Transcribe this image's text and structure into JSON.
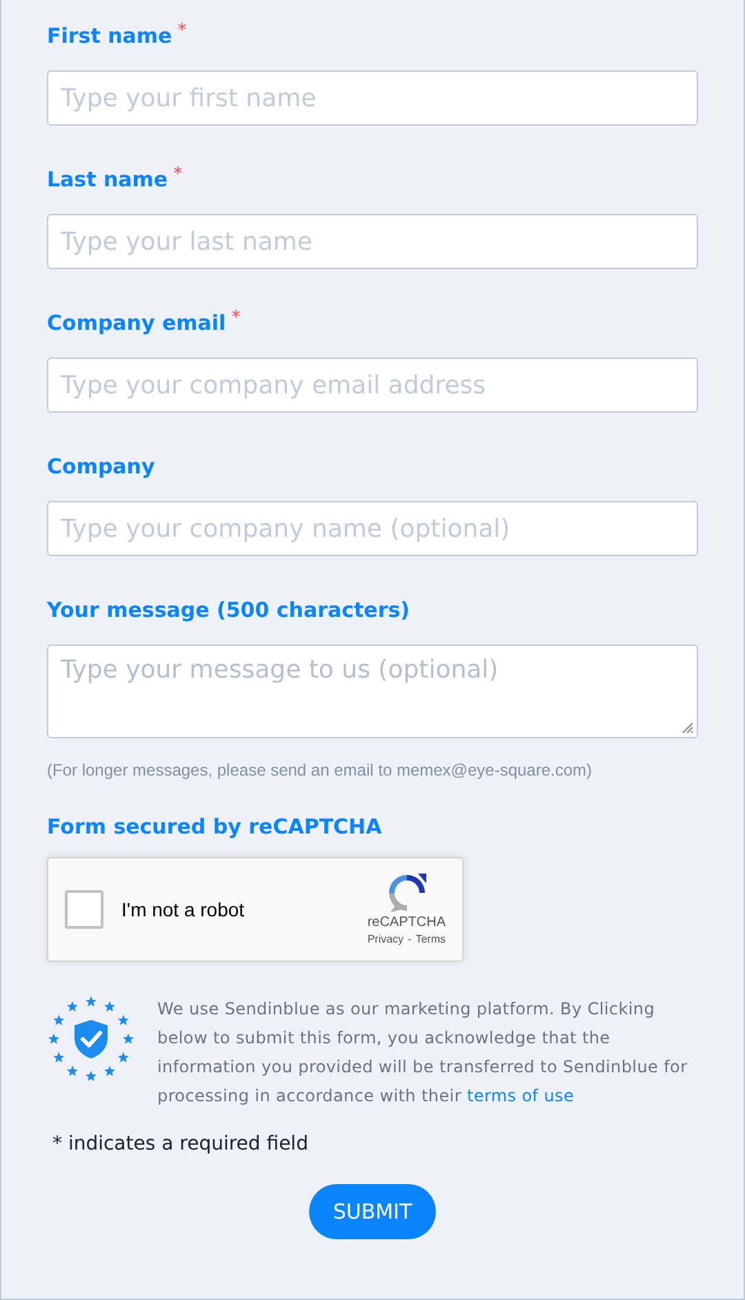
{
  "fields": [
    {
      "kind": "text",
      "label": "First name",
      "required_mark": "*",
      "placeholder": "Type your first name"
    },
    {
      "kind": "text",
      "label": "Last name",
      "required_mark": "*",
      "placeholder": "Type your last name"
    },
    {
      "kind": "text",
      "label": "Company email",
      "required_mark": "*",
      "placeholder": "Type your company email address"
    },
    {
      "kind": "text",
      "label": "Company",
      "placeholder": "Type your company name (optional)"
    },
    {
      "kind": "textarea",
      "label": "Your message (500 characters)",
      "placeholder": "Type your message to us (optional)"
    }
  ],
  "message_hint": "(For longer messages, please send an email to memex@eye-square.com)",
  "captcha": {
    "heading": "Form secured by reCAPTCHA",
    "label": "I'm not a robot",
    "checked": false,
    "brand": "reCAPTCHA",
    "privacy": "Privacy",
    "separator": "-",
    "terms": "Terms"
  },
  "disclaimer": {
    "text": "We use Sendinblue as our marketing platform. By Clicking below to submit this form, you acknowledge that the information you provided will be transferred to Sendinblue for processing in accordance with their",
    "link": "terms of use"
  },
  "required_note": "* indicates a required field",
  "submit": "SUBMIT"
}
